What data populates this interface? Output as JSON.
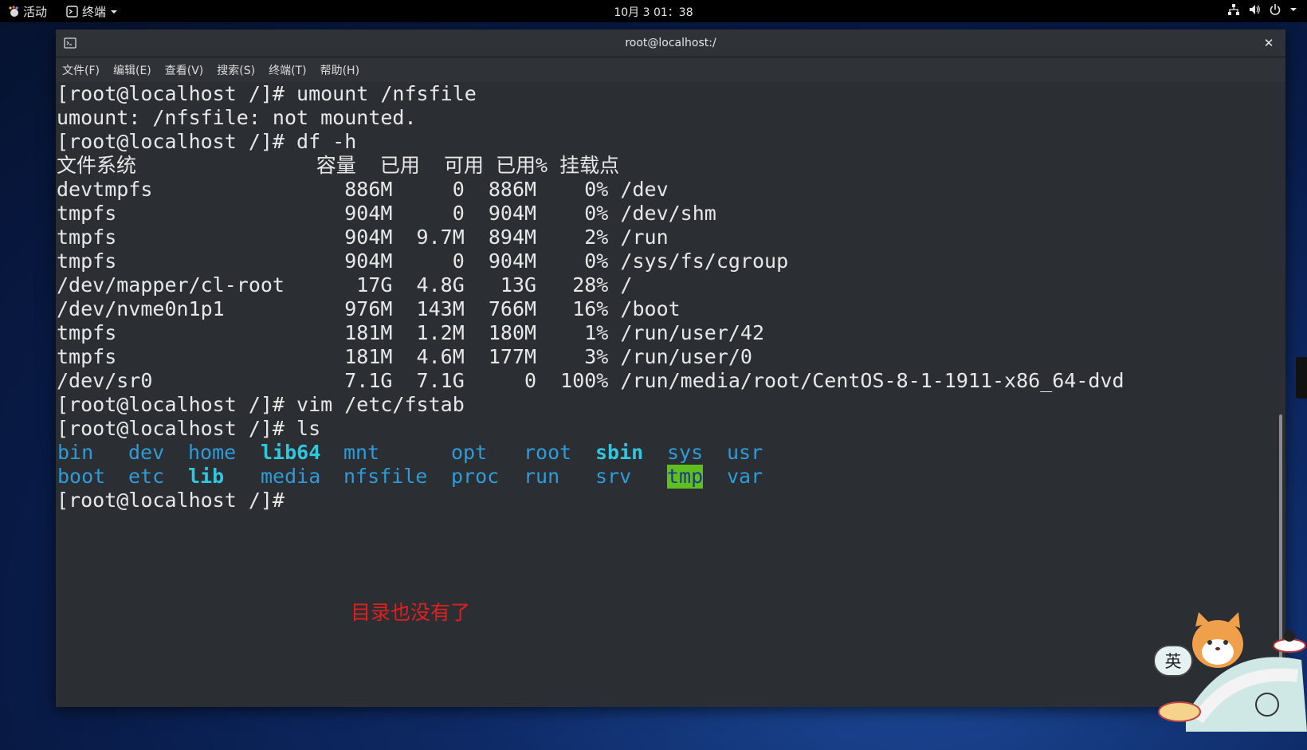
{
  "topbar": {
    "activities": "活动",
    "app_name": "终端",
    "clock": "10月 3  01：38",
    "tray_icons": [
      "network-icon",
      "volume-icon",
      "power-icon",
      "chevron-down-icon"
    ]
  },
  "window": {
    "title": "root@localhost:/",
    "close": "✕",
    "menu": [
      "文件(F)",
      "编辑(E)",
      "查看(V)",
      "搜索(S)",
      "终端(T)",
      "帮助(H)"
    ]
  },
  "terminal": {
    "lines": [
      "[root@localhost /]# umount /nfsfile",
      "umount: /nfsfile: not mounted.",
      "[root@localhost /]# df -h",
      "文件系统               容量  已用  可用 已用% 挂载点",
      "devtmpfs                886M     0  886M    0% /dev",
      "tmpfs                   904M     0  904M    0% /dev/shm",
      "tmpfs                   904M  9.7M  894M    2% /run",
      "tmpfs                   904M     0  904M    0% /sys/fs/cgroup",
      "/dev/mapper/cl-root      17G  4.8G   13G   28% /",
      "/dev/nvme0n1p1          976M  143M  766M   16% /boot",
      "tmpfs                   181M  1.2M  180M    1% /run/user/42",
      "tmpfs                   181M  4.6M  177M    3% /run/user/0",
      "/dev/sr0                7.1G  7.1G     0  100% /run/media/root/CentOS-8-1-1911-x86_64-dvd",
      "[root@localhost /]# vim /etc/fstab",
      "[root@localhost /]# ls"
    ],
    "ls_row1": [
      "bin",
      "dev",
      "home",
      "lib64",
      "mnt",
      "opt",
      "root",
      "sbin",
      "sys",
      "usr"
    ],
    "ls_row2": [
      "boot",
      "etc",
      "lib",
      "media",
      "nfsfile",
      "proc",
      "run",
      "srv",
      "tmp",
      "var"
    ],
    "prompt": "[root@localhost /]#",
    "annotation": "目录也没有了"
  },
  "ime": {
    "mode_label": "英"
  },
  "colors": {
    "ls_dir": "#2f9bd9",
    "ls_link": "#33c7de",
    "sticky_bg": "#5fbf1f",
    "annotation": "#e02020"
  }
}
